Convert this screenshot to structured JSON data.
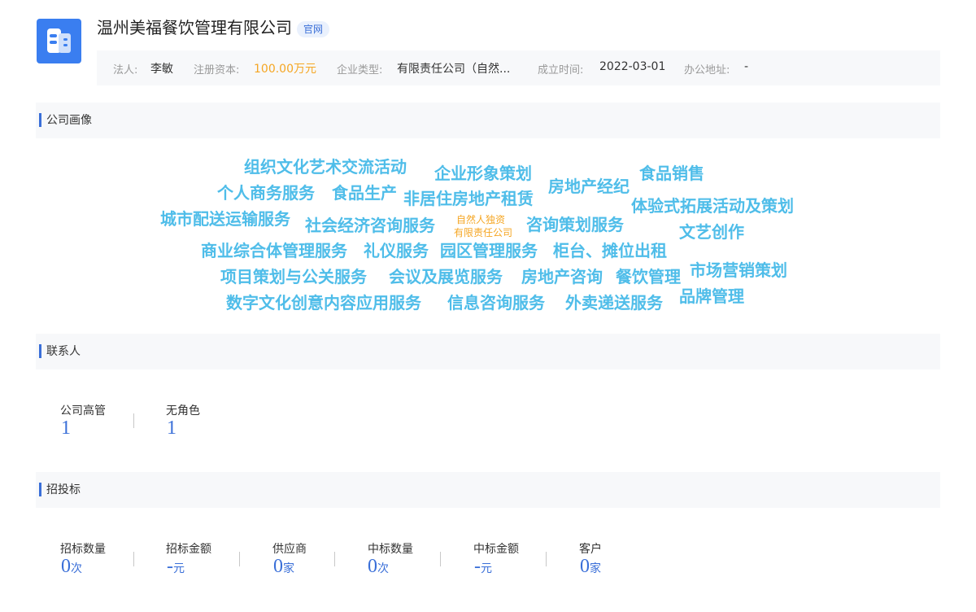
{
  "company": {
    "name": "温州美福餐饮管理有限公司",
    "official_tag": "官网",
    "logo_icon": "building-icon"
  },
  "info_bar": {
    "legal_rep_label": "法人:",
    "legal_rep_value": "李敏",
    "capital_label": "注册资本:",
    "capital_value": "100.00万元",
    "type_label": "企业类型:",
    "type_value": "有限责任公司（自然...",
    "founded_label": "成立时间:",
    "founded_value": "2022-03-01",
    "address_label": "办公地址:",
    "address_value": "-"
  },
  "sections": {
    "profile": "公司画像",
    "contacts": "联系人",
    "bidding": "招投标"
  },
  "word_cloud": [
    "组织文化艺术交流活动",
    "企业形象策划",
    "食品销售",
    "个人商务服务",
    "食品生产",
    "非居住房地产租赁",
    "房地产经纪",
    "体验式拓展活动及策划",
    "城市配送运输服务",
    "社会经济咨询服务",
    "自然人独资",
    "有限责任公司",
    "咨询策划服务",
    "文艺创作",
    "商业综合体管理服务",
    "礼仪服务",
    "园区管理服务",
    "柜台、摊位出租",
    "项目策划与公关服务",
    "会议及展览服务",
    "房地产咨询",
    "餐饮管理",
    "市场营销策划",
    "数字文化创意内容应用服务",
    "信息咨询服务",
    "外卖递送服务",
    "品牌管理"
  ],
  "contacts": [
    {
      "label": "公司高管",
      "value": "1"
    },
    {
      "label": "无角色",
      "value": "1"
    }
  ],
  "bidding": [
    {
      "label": "招标数量",
      "value": "0",
      "unit": "次"
    },
    {
      "label": "招标金额",
      "value": "-",
      "unit": "元"
    },
    {
      "label": "供应商",
      "value": "0",
      "unit": "家"
    },
    {
      "label": "中标数量",
      "value": "0",
      "unit": "次"
    },
    {
      "label": "中标金额",
      "value": "-",
      "unit": "元"
    },
    {
      "label": "客户",
      "value": "0",
      "unit": "家"
    }
  ]
}
